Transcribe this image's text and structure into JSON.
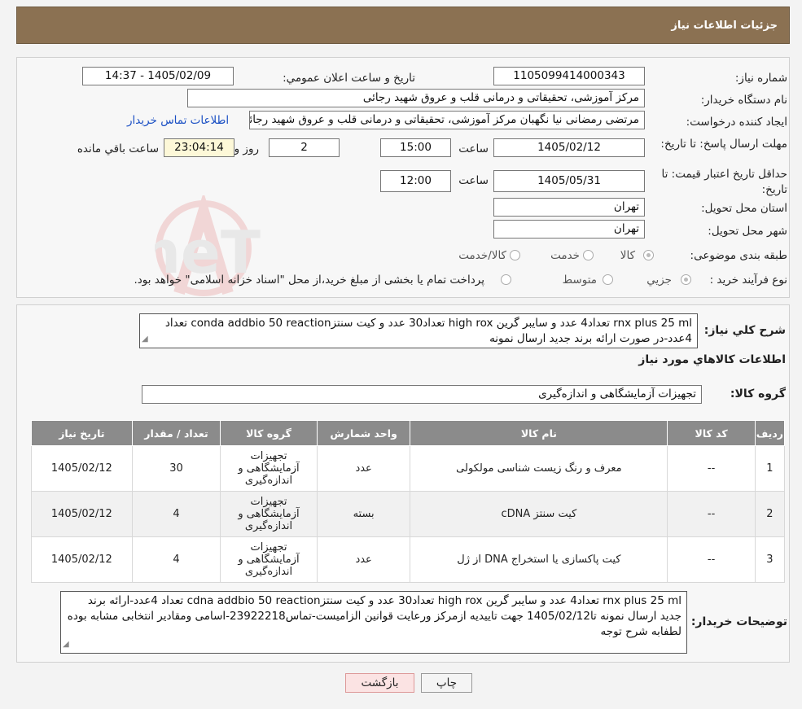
{
  "header": {
    "title": "جزئیات اطلاعات نیاز"
  },
  "watermark": {
    "text": "AriaTender.neT"
  },
  "form": {
    "need_number_label": "شماره نیاز:",
    "need_number": "1105099414000343",
    "announce_label": "تاریخ و ساعت اعلان عمومي:",
    "announce_value": "1405/02/09 - 14:37",
    "buyer_label": "نام دستگاه خریدار:",
    "buyer_value": "مرکز آموزشی، تحقیقاتی و درمانی قلب و عروق شهید رجائی",
    "creator_label": "ایجاد کننده درخواست:",
    "creator_value": "مرتضی رمضانی نیا نگهبان مرکز آموزشی، تحقیقاتی و درمانی قلب و عروق شهید رجائی",
    "contact_link": "اطلاعات تماس خریدار",
    "deadline_label": "مهلت ارسال پاسخ: تا تاریخ:",
    "deadline_date": "1405/02/12",
    "time_label": "ساعت",
    "deadline_time": "15:00",
    "days_value": "2",
    "days_label": "روز و",
    "remaining_time": "23:04:14",
    "remaining_label": "ساعت باقي مانده",
    "validity_label": "حداقل تاریخ اعتبار قیمت: تا تاریخ:",
    "validity_date": "1405/05/31",
    "validity_time": "12:00",
    "province_label": "استان محل تحویل:",
    "province_value": "تهران",
    "city_label": "شهر محل تحویل:",
    "city_value": "تهران",
    "category_label": "طبقه بندی موضوعی:",
    "category_options": [
      "کالا",
      "خدمت",
      "کالا/خدمت"
    ],
    "category_selected": "کالا",
    "process_label": "نوع فرآیند خرید :",
    "process_options": [
      "جزیي",
      "متوسط"
    ],
    "process_selected": "جزیي",
    "process_note": "پرداخت تمام یا بخشی از مبلغ خرید،از محل \"اسناد خزانه اسلامی\" خواهد بود."
  },
  "summary": {
    "label": "شرح کلي نیاز:",
    "text": "rnx plus 25 ml تعداد4 عدد و سایبر گرین high rox تعداد30 عدد و کیت سنتزconda addbio 50 reaction تعداد 4عدد-در صورت ارائه برند جدید ارسال نمونه"
  },
  "goods_section": {
    "title": "اطلاعات کالاهاي مورد نیاز",
    "group_label": "گروه کالا:",
    "group_value": "تجهیزات آزمایشگاهی و اندازه‌گیری"
  },
  "table": {
    "headers": [
      "ردیف",
      "کد کالا",
      "نام کالا",
      "واحد شمارش",
      "گروه کالا",
      "تعداد / مقدار",
      "تاریخ نیاز"
    ],
    "rows": [
      [
        "1",
        "--",
        "معرف و رنگ زیست شناسی مولکولی",
        "عدد",
        "تجهیزات آزمایشگاهی و اندازه‌گیری",
        "30",
        "1405/02/12"
      ],
      [
        "2",
        "--",
        "کیت سنتز cDNA",
        "بسته",
        "تجهیزات آزمایشگاهی و اندازه‌گیری",
        "4",
        "1405/02/12"
      ],
      [
        "3",
        "--",
        "کیت پاکسازی یا استخراج DNA از ژل",
        "عدد",
        "تجهیزات آزمایشگاهی و اندازه‌گیری",
        "4",
        "1405/02/12"
      ]
    ]
  },
  "buyer_notes": {
    "label": "توضیحات خریدار:",
    "text": "rnx plus 25 ml تعداد4 عدد و سایبر گرین high rox تعداد30 عدد و کیت سنتزcdna addbio 50 reaction تعداد 4عدد-ارائه برند جدید ارسال نمونه تا1405/02/12 جهت تاییدیه ازمرکز ورعایت قوانین الزامیست-تماس23922218-اسامی ومقادیر انتخابی مشابه بوده لطفابه شرح توجه"
  },
  "buttons": {
    "print": "چاپ",
    "back": "بازگشت"
  },
  "colors": {
    "header_bg": "#8b7152",
    "table_header_bg": "#8b8b8b",
    "link": "#1a4fc4",
    "back_btn_bg": "#fbe3e3"
  }
}
